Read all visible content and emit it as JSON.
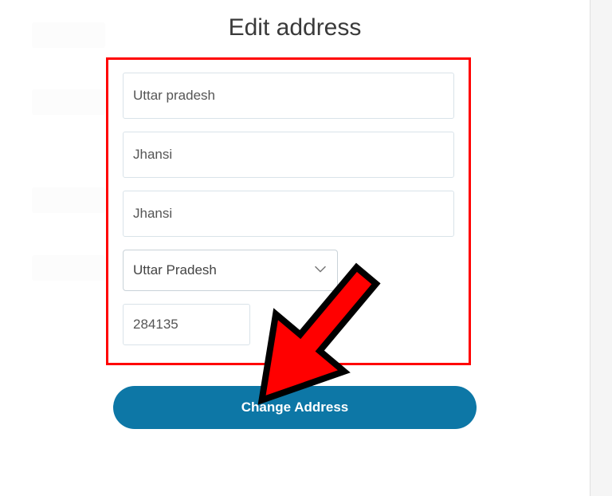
{
  "title": "Edit address",
  "form": {
    "field1_value": "Uttar pradesh",
    "field2_value": "Jhansi",
    "field3_value": "Jhansi",
    "state_selected": "Uttar Pradesh",
    "pin_value": "284135"
  },
  "submit_label": "Change Address"
}
